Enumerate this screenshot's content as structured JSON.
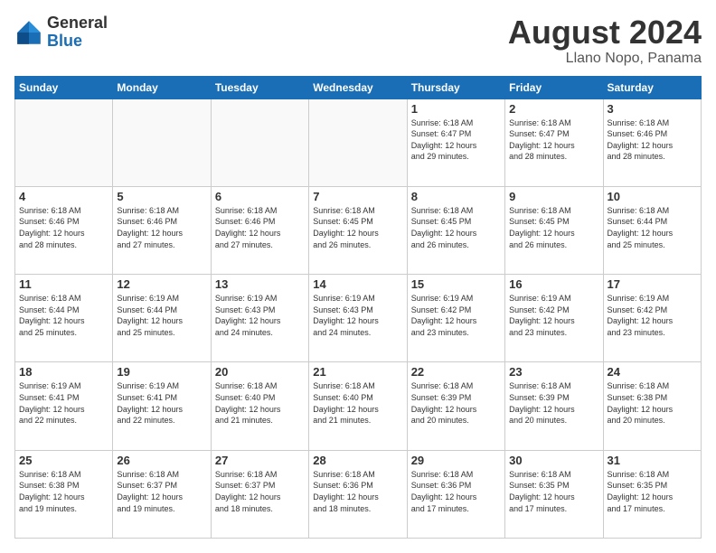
{
  "header": {
    "logo_general": "General",
    "logo_blue": "Blue",
    "month_year": "August 2024",
    "location": "Llano Nopo, Panama"
  },
  "days_of_week": [
    "Sunday",
    "Monday",
    "Tuesday",
    "Wednesday",
    "Thursday",
    "Friday",
    "Saturday"
  ],
  "weeks": [
    [
      {
        "day": "",
        "text": ""
      },
      {
        "day": "",
        "text": ""
      },
      {
        "day": "",
        "text": ""
      },
      {
        "day": "",
        "text": ""
      },
      {
        "day": "1",
        "text": "Sunrise: 6:18 AM\nSunset: 6:47 PM\nDaylight: 12 hours\nand 29 minutes."
      },
      {
        "day": "2",
        "text": "Sunrise: 6:18 AM\nSunset: 6:47 PM\nDaylight: 12 hours\nand 28 minutes."
      },
      {
        "day": "3",
        "text": "Sunrise: 6:18 AM\nSunset: 6:46 PM\nDaylight: 12 hours\nand 28 minutes."
      }
    ],
    [
      {
        "day": "4",
        "text": "Sunrise: 6:18 AM\nSunset: 6:46 PM\nDaylight: 12 hours\nand 28 minutes."
      },
      {
        "day": "5",
        "text": "Sunrise: 6:18 AM\nSunset: 6:46 PM\nDaylight: 12 hours\nand 27 minutes."
      },
      {
        "day": "6",
        "text": "Sunrise: 6:18 AM\nSunset: 6:46 PM\nDaylight: 12 hours\nand 27 minutes."
      },
      {
        "day": "7",
        "text": "Sunrise: 6:18 AM\nSunset: 6:45 PM\nDaylight: 12 hours\nand 26 minutes."
      },
      {
        "day": "8",
        "text": "Sunrise: 6:18 AM\nSunset: 6:45 PM\nDaylight: 12 hours\nand 26 minutes."
      },
      {
        "day": "9",
        "text": "Sunrise: 6:18 AM\nSunset: 6:45 PM\nDaylight: 12 hours\nand 26 minutes."
      },
      {
        "day": "10",
        "text": "Sunrise: 6:18 AM\nSunset: 6:44 PM\nDaylight: 12 hours\nand 25 minutes."
      }
    ],
    [
      {
        "day": "11",
        "text": "Sunrise: 6:18 AM\nSunset: 6:44 PM\nDaylight: 12 hours\nand 25 minutes."
      },
      {
        "day": "12",
        "text": "Sunrise: 6:19 AM\nSunset: 6:44 PM\nDaylight: 12 hours\nand 25 minutes."
      },
      {
        "day": "13",
        "text": "Sunrise: 6:19 AM\nSunset: 6:43 PM\nDaylight: 12 hours\nand 24 minutes."
      },
      {
        "day": "14",
        "text": "Sunrise: 6:19 AM\nSunset: 6:43 PM\nDaylight: 12 hours\nand 24 minutes."
      },
      {
        "day": "15",
        "text": "Sunrise: 6:19 AM\nSunset: 6:42 PM\nDaylight: 12 hours\nand 23 minutes."
      },
      {
        "day": "16",
        "text": "Sunrise: 6:19 AM\nSunset: 6:42 PM\nDaylight: 12 hours\nand 23 minutes."
      },
      {
        "day": "17",
        "text": "Sunrise: 6:19 AM\nSunset: 6:42 PM\nDaylight: 12 hours\nand 23 minutes."
      }
    ],
    [
      {
        "day": "18",
        "text": "Sunrise: 6:19 AM\nSunset: 6:41 PM\nDaylight: 12 hours\nand 22 minutes."
      },
      {
        "day": "19",
        "text": "Sunrise: 6:19 AM\nSunset: 6:41 PM\nDaylight: 12 hours\nand 22 minutes."
      },
      {
        "day": "20",
        "text": "Sunrise: 6:18 AM\nSunset: 6:40 PM\nDaylight: 12 hours\nand 21 minutes."
      },
      {
        "day": "21",
        "text": "Sunrise: 6:18 AM\nSunset: 6:40 PM\nDaylight: 12 hours\nand 21 minutes."
      },
      {
        "day": "22",
        "text": "Sunrise: 6:18 AM\nSunset: 6:39 PM\nDaylight: 12 hours\nand 20 minutes."
      },
      {
        "day": "23",
        "text": "Sunrise: 6:18 AM\nSunset: 6:39 PM\nDaylight: 12 hours\nand 20 minutes."
      },
      {
        "day": "24",
        "text": "Sunrise: 6:18 AM\nSunset: 6:38 PM\nDaylight: 12 hours\nand 20 minutes."
      }
    ],
    [
      {
        "day": "25",
        "text": "Sunrise: 6:18 AM\nSunset: 6:38 PM\nDaylight: 12 hours\nand 19 minutes."
      },
      {
        "day": "26",
        "text": "Sunrise: 6:18 AM\nSunset: 6:37 PM\nDaylight: 12 hours\nand 19 minutes."
      },
      {
        "day": "27",
        "text": "Sunrise: 6:18 AM\nSunset: 6:37 PM\nDaylight: 12 hours\nand 18 minutes."
      },
      {
        "day": "28",
        "text": "Sunrise: 6:18 AM\nSunset: 6:36 PM\nDaylight: 12 hours\nand 18 minutes."
      },
      {
        "day": "29",
        "text": "Sunrise: 6:18 AM\nSunset: 6:36 PM\nDaylight: 12 hours\nand 17 minutes."
      },
      {
        "day": "30",
        "text": "Sunrise: 6:18 AM\nSunset: 6:35 PM\nDaylight: 12 hours\nand 17 minutes."
      },
      {
        "day": "31",
        "text": "Sunrise: 6:18 AM\nSunset: 6:35 PM\nDaylight: 12 hours\nand 17 minutes."
      }
    ]
  ]
}
